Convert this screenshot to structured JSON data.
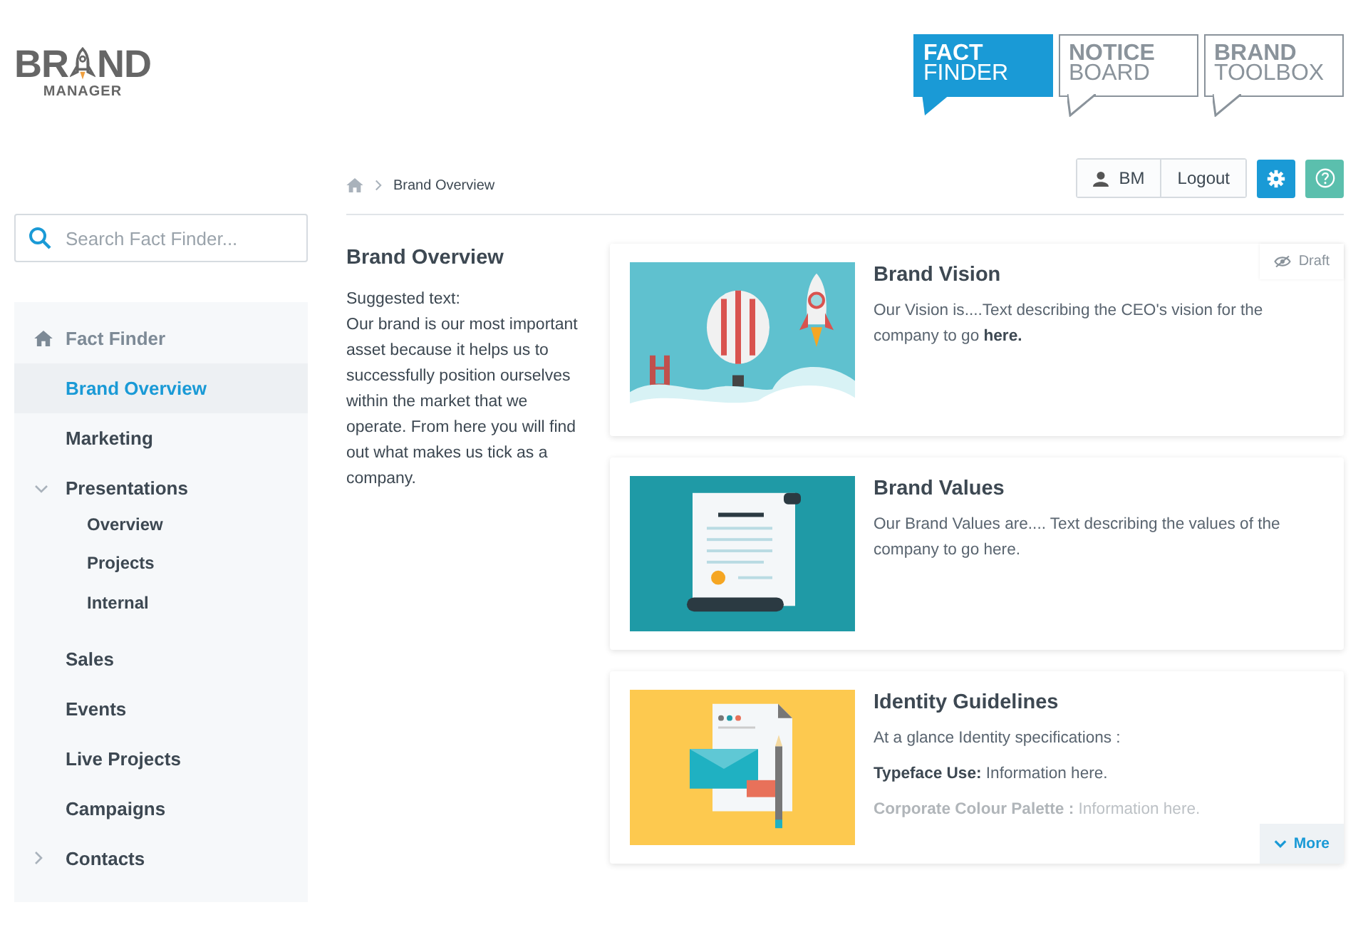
{
  "logo": {
    "text_before": "BR",
    "text_after": "ND",
    "subtitle": "MANAGER"
  },
  "tabs": [
    {
      "line1": "FACT",
      "line2": "FINDER",
      "selected": true
    },
    {
      "line1": "NOTICE",
      "line2": "BOARD",
      "selected": false
    },
    {
      "line1": "BRAND",
      "line2": "TOOLBOX",
      "selected": false
    }
  ],
  "search": {
    "placeholder": "Search Fact Finder..."
  },
  "nav": [
    {
      "label": "Fact Finder",
      "kind": "home",
      "selected": false
    },
    {
      "label": "Brand Overview",
      "selected": true
    },
    {
      "label": "Marketing",
      "selected": false
    },
    {
      "label": "Presentations",
      "selected": false,
      "expanded": true,
      "children": [
        {
          "label": "Overview",
          "selected": false
        },
        {
          "label": "Projects",
          "selected": false
        },
        {
          "label": "Internal",
          "selected": false
        }
      ]
    },
    {
      "label": "Sales",
      "selected": false
    },
    {
      "label": "Events",
      "selected": false
    },
    {
      "label": "Live Projects",
      "selected": false
    },
    {
      "label": "Campaigns",
      "selected": false
    },
    {
      "label": "Contacts",
      "selected": false,
      "expanded": false
    }
  ],
  "breadcrumb": {
    "current": "Brand Overview"
  },
  "user": {
    "initials": "BM",
    "logout": "Logout"
  },
  "overview": {
    "title": "Brand Overview",
    "lines": [
      "Suggested text:",
      "Our brand is our most important asset because it helps us to successfully position ourselves within the market that we operate. From here you will find out what makes us tick as a company."
    ]
  },
  "cards": [
    {
      "kind": "picture",
      "title": "Brand Vision",
      "paragraphs": [
        "Our Vision is....Text describing the CEO's vision for the company to go **here.**"
      ],
      "draft": "Draft",
      "collapsed": false
    },
    {
      "kind": "picture",
      "title": "Brand Values",
      "paragraphs": [
        "Our Brand Values are.... Text describing the values of the company to go here."
      ],
      "collapsed": false
    },
    {
      "kind": "picture",
      "title": "Identity Guidelines",
      "paragraphs": [
        "At a glance Identity specifications :",
        "**Typeface Use:** Information here.",
        "**Corporate Colour Palette :** Information here."
      ],
      "collapsed": true,
      "more": "More"
    }
  ]
}
